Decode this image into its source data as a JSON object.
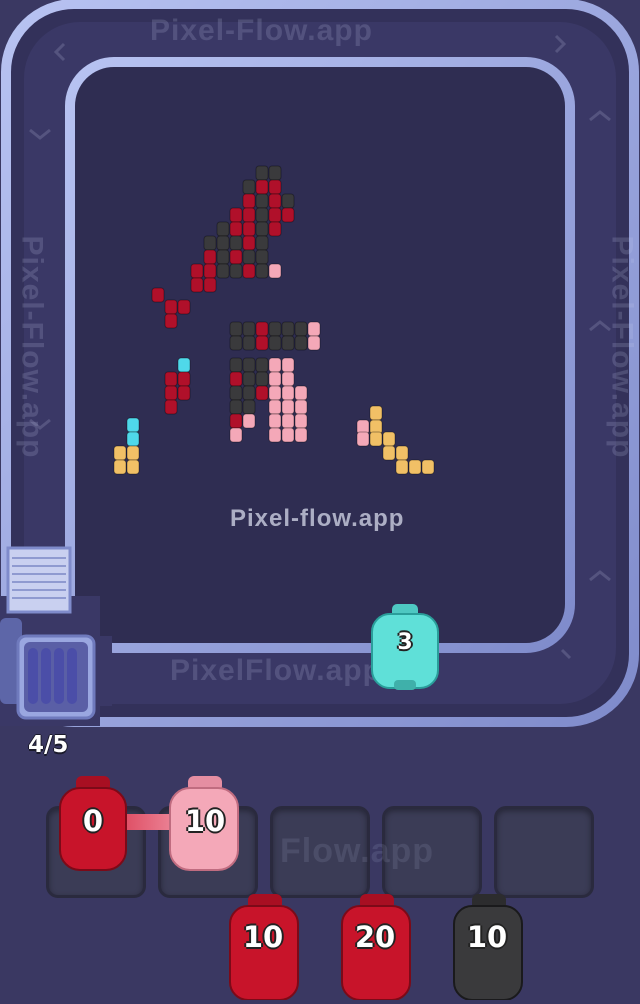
{
  "watermark": {
    "top": "Pixel-Flow.app",
    "center": "Pixel-flow.app",
    "bottom": "PixelFlow.app",
    "left": "Pixel-Flow.app",
    "right": "Pixel-Flow.app",
    "slots": "Flow.app"
  },
  "queue": {
    "counter": "4/5"
  },
  "conveyor_pig": {
    "value": "3",
    "color": "#5fe0d8"
  },
  "slot_pigs": [
    {
      "value": "0",
      "color": "#c8142a"
    },
    {
      "value": "10",
      "color": "#f4a8b8"
    }
  ],
  "bottom_pigs": [
    {
      "value": "10",
      "color": "#c8142a"
    },
    {
      "value": "20",
      "color": "#c8142a"
    },
    {
      "value": "10",
      "color": "#3a3a3c"
    }
  ],
  "colors": {
    "background": "#3a3862",
    "track": "#9aa7e0",
    "board": "#2f2d52",
    "red": "#b0102a",
    "dark": "#3a3a3c",
    "pink": "#f4a8b8",
    "gold": "#f1c066",
    "cyan": "#4fd8ea"
  }
}
